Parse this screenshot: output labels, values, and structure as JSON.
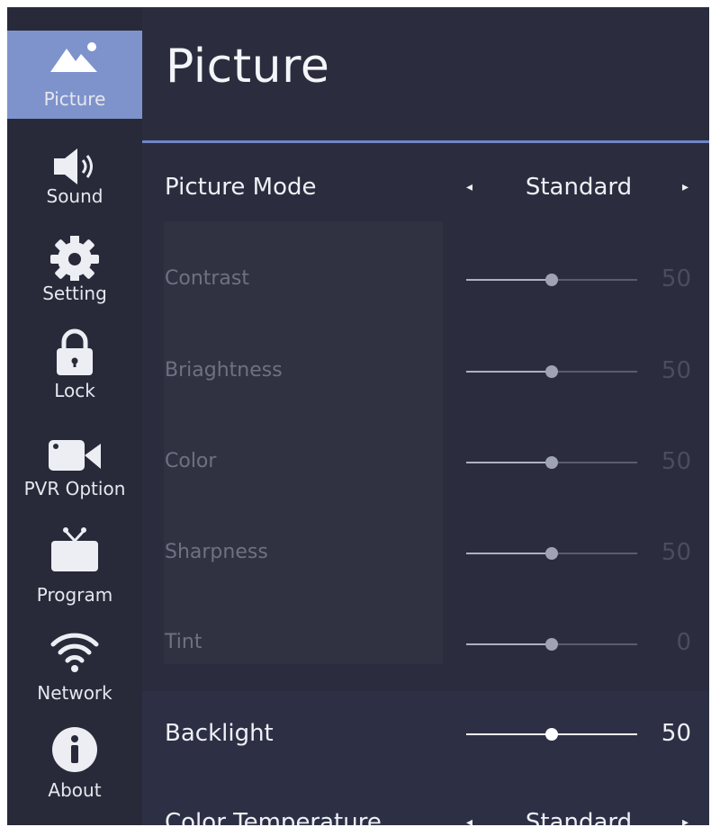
{
  "sidebar": {
    "items": [
      {
        "label": "Picture",
        "icon": "picture-icon",
        "active": true
      },
      {
        "label": "Sound",
        "icon": "speaker-icon"
      },
      {
        "label": "Setting",
        "icon": "gear-icon"
      },
      {
        "label": "Lock",
        "icon": "lock-icon"
      },
      {
        "label": "PVR Option",
        "icon": "video-camera-icon"
      },
      {
        "label": "Program",
        "icon": "tv-icon"
      },
      {
        "label": "Network",
        "icon": "wifi-icon"
      },
      {
        "label": "About",
        "icon": "info-icon"
      }
    ]
  },
  "page": {
    "title": "Picture"
  },
  "settings": {
    "picture_mode": {
      "label": "Picture Mode",
      "value": "Standard",
      "left_arrow": "◂",
      "right_arrow": "▸"
    },
    "contrast": {
      "label": "Contrast",
      "value": "50",
      "level": 0.5
    },
    "brightness": {
      "label": "Briaghtness",
      "value": "50",
      "level": 0.5
    },
    "color": {
      "label": "Color",
      "value": "50",
      "level": 0.5
    },
    "sharpness": {
      "label": "Sharpness",
      "value": "50",
      "level": 0.5
    },
    "tint": {
      "label": "Tint",
      "value": "0",
      "level": 0.5
    },
    "backlight": {
      "label": "Backlight",
      "value": "50",
      "level": 0.5
    },
    "color_temperature": {
      "label": "Color Temperature",
      "value": "Standard",
      "left_arrow": "◂",
      "right_arrow": "▸"
    }
  },
  "colors": {
    "accent": "#7e93cc",
    "background": "#2b2d3f",
    "sidebar": "#282a3a"
  }
}
